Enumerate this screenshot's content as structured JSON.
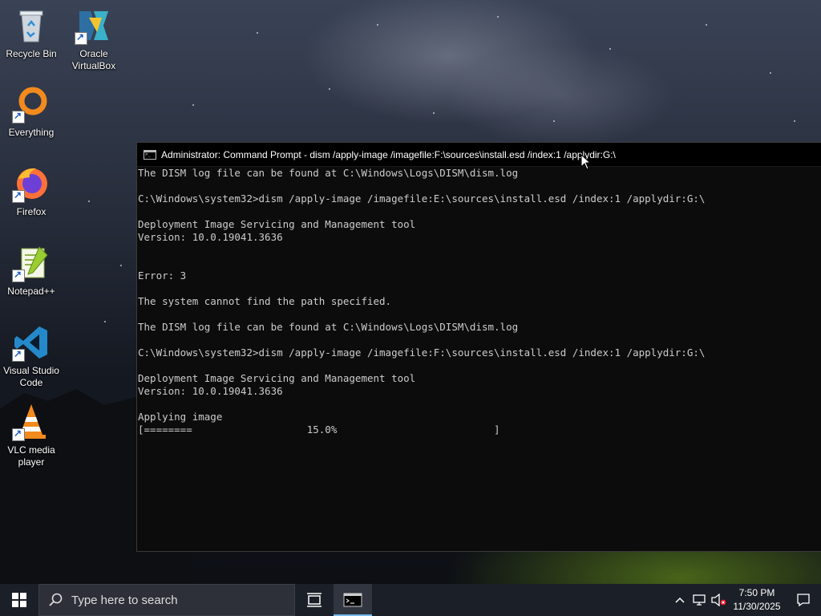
{
  "desktop": {
    "icons": [
      {
        "label": "Recycle Bin",
        "icon": "recycle-bin-icon"
      },
      {
        "label": "Oracle\nVirtualBox",
        "icon": "virtualbox-icon"
      },
      {
        "label": "Everything",
        "icon": "everything-icon"
      },
      {
        "label": "Firefox",
        "icon": "firefox-icon"
      },
      {
        "label": "Notepad++",
        "icon": "notepadpp-icon"
      },
      {
        "label": "Visual Studio\nCode",
        "icon": "vscode-icon"
      },
      {
        "label": "VLC media\nplayer",
        "icon": "vlc-icon"
      }
    ]
  },
  "console": {
    "title": "Administrator: Command Prompt - dism  /apply-image /imagefile:F:\\sources\\install.esd /index:1 /applydir:G:\\",
    "lines": [
      "The DISM log file can be found at C:\\Windows\\Logs\\DISM\\dism.log",
      "",
      "C:\\Windows\\system32>dism /apply-image /imagefile:E:\\sources\\install.esd /index:1 /applydir:G:\\",
      "",
      "Deployment Image Servicing and Management tool",
      "Version: 10.0.19041.3636",
      "",
      "",
      "Error: 3",
      "",
      "The system cannot find the path specified.",
      "",
      "The DISM log file can be found at C:\\Windows\\Logs\\DISM\\dism.log",
      "",
      "C:\\Windows\\system32>dism /apply-image /imagefile:F:\\sources\\install.esd /index:1 /applydir:G:\\",
      "",
      "Deployment Image Servicing and Management tool",
      "Version: 10.0.19041.3636",
      "",
      "Applying image",
      "[========                   15.0%                          ]"
    ],
    "progress_percent": 15.0
  },
  "taskbar": {
    "search_placeholder": "Type here to search",
    "time": "7:50 PM",
    "date": "11/30/2025",
    "tray_icons": [
      "chevron-up-icon",
      "network-icon",
      "volume-muted-icon"
    ]
  },
  "colors": {
    "console_bg": "#0c0c0c",
    "console_text": "#cccccc",
    "taskbar_bg": "#1b1f27",
    "active_indicator": "#76b9ed"
  }
}
